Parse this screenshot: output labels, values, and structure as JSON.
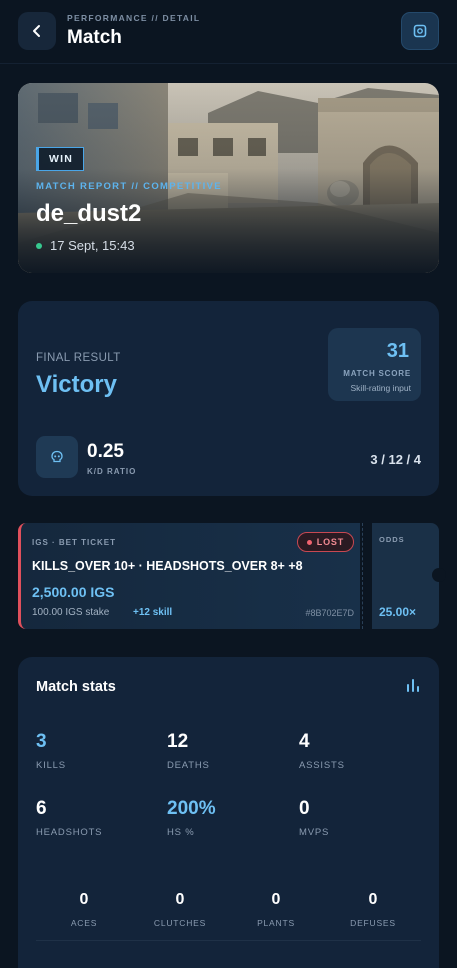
{
  "header": {
    "kicker": "PERFORMANCE // DETAIL",
    "title": "Match",
    "back_icon": "chevron-left-icon",
    "action_icon": "screenshot-icon"
  },
  "hero": {
    "badge": "WIN",
    "kicker": "MATCH REPORT // COMPETITIVE",
    "map": "de_dust2",
    "date": "17 Sept, 15:43"
  },
  "result": {
    "label": "FINAL RESULT",
    "value": "Victory",
    "score": "31",
    "score_label": "MATCH SCORE",
    "score_sub": "Skill-rating input",
    "kd_value": "0.25",
    "kd_label": "K/D RATIO",
    "kda": "3 / 12 / 4"
  },
  "ticket": {
    "kicker": "IGS · BET TICKET",
    "status": "LOST",
    "title": "KILLS_OVER 10+ · HEADSHOTS_OVER 8+ +8",
    "amount": "2,500.00 IGS",
    "stake": "100.00 IGS stake",
    "skill": "+12 skill",
    "hash": "#8B702E7D",
    "odds_label": "ODDS",
    "odds_value": "25.00×"
  },
  "stats": {
    "title": "Match stats",
    "items": [
      {
        "value": "3",
        "label": "KILLS"
      },
      {
        "value": "12",
        "label": "DEATHS"
      },
      {
        "value": "4",
        "label": "ASSISTS"
      },
      {
        "value": "6",
        "label": "HEADSHOTS"
      },
      {
        "value": "200%",
        "label": "HS %"
      },
      {
        "value": "0",
        "label": "MVPS"
      }
    ],
    "minor": [
      {
        "value": "0",
        "label": "ACES"
      },
      {
        "value": "0",
        "label": "CLUTCHES"
      },
      {
        "value": "0",
        "label": "PLANTS"
      },
      {
        "value": "0",
        "label": "DEFUSES"
      }
    ]
  },
  "colors": {
    "background": "#0b1521",
    "card": "#13243a",
    "accent": "#6ec0f3",
    "loss": "#e0505c",
    "online": "#37c98f"
  }
}
